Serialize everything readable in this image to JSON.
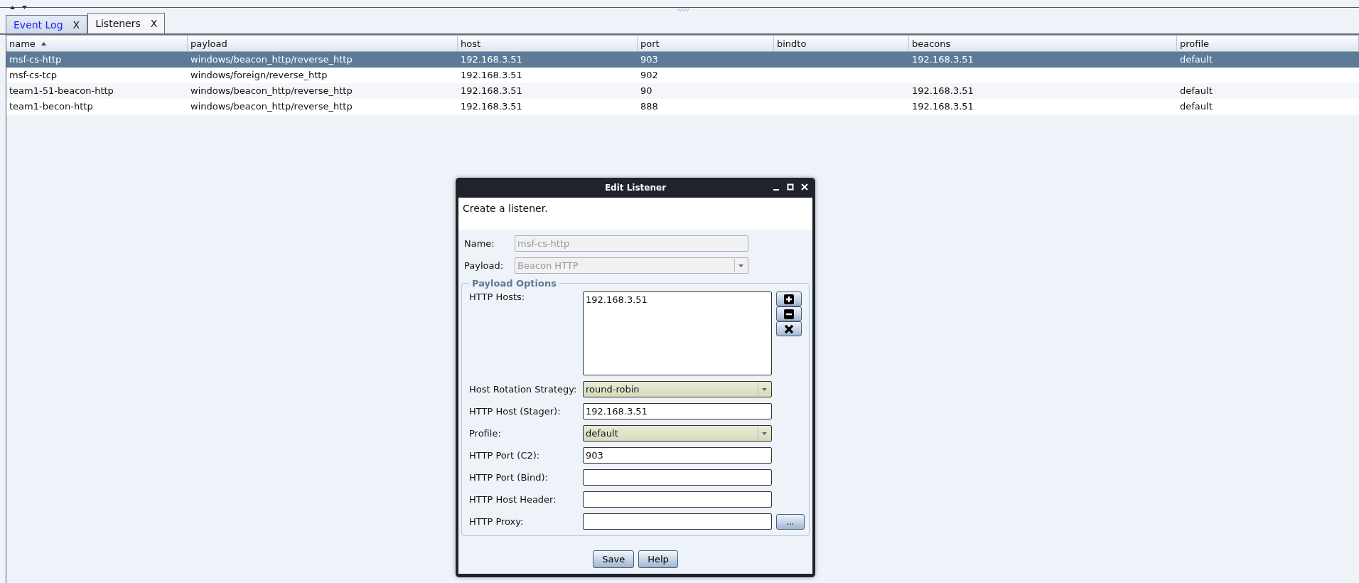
{
  "tabs": [
    {
      "label": "Event Log",
      "close": "X",
      "selected": false
    },
    {
      "label": "Listeners",
      "close": "X",
      "selected": true
    }
  ],
  "table": {
    "columns": [
      {
        "label": "name",
        "sorted": true
      },
      {
        "label": "payload",
        "sorted": false
      },
      {
        "label": "host",
        "sorted": false
      },
      {
        "label": "port",
        "sorted": false
      },
      {
        "label": "bindto",
        "sorted": false
      },
      {
        "label": "beacons",
        "sorted": false
      },
      {
        "label": "profile",
        "sorted": false
      }
    ],
    "rows": [
      {
        "cells": [
          "msf-cs-http",
          "windows/beacon_http/reverse_http",
          "192.168.3.51",
          "903",
          "",
          "192.168.3.51",
          "default"
        ],
        "selected": true
      },
      {
        "cells": [
          "msf-cs-tcp",
          "windows/foreign/reverse_http",
          "192.168.3.51",
          "902",
          "",
          "",
          ""
        ],
        "selected": false
      },
      {
        "cells": [
          "team1-51-beacon-http",
          "windows/beacon_http/reverse_http",
          "192.168.3.51",
          "90",
          "",
          "192.168.3.51",
          "default"
        ],
        "selected": false
      },
      {
        "cells": [
          "team1-becon-http",
          "windows/beacon_http/reverse_http",
          "192.168.3.51",
          "888",
          "",
          "192.168.3.51",
          "default"
        ],
        "selected": false
      }
    ]
  },
  "dialog": {
    "title": "Edit Listener",
    "description": "Create a listener.",
    "fields": [
      {
        "kind": "text",
        "label": "Name:",
        "value": "msf-cs-http",
        "disabled": true
      },
      {
        "kind": "select",
        "label": "Payload:",
        "value": "Beacon HTTP",
        "disabled": true
      }
    ],
    "group": {
      "title": "Payload Options",
      "fields": [
        {
          "kind": "list",
          "label": "HTTP Hosts:",
          "items": [
            "192.168.3.51"
          ]
        },
        {
          "kind": "select",
          "label": "Host Rotation Strategy:",
          "value": "round-robin",
          "disabled": false
        },
        {
          "kind": "text",
          "label": "HTTP Host (Stager):",
          "value": "192.168.3.51",
          "disabled": false
        },
        {
          "kind": "select",
          "label": "Profile:",
          "value": "default",
          "disabled": false
        },
        {
          "kind": "text",
          "label": "HTTP Port (C2):",
          "value": "903",
          "disabled": false
        },
        {
          "kind": "text",
          "label": "HTTP Port (Bind):",
          "disabled": false
        },
        {
          "kind": "text",
          "label": "HTTP Host Header:",
          "disabled": false
        },
        {
          "kind": "proxy",
          "label": "HTTP Proxy:",
          "button": "...",
          "disabled": false
        }
      ]
    },
    "buttons": [
      "Save",
      "Help"
    ]
  }
}
